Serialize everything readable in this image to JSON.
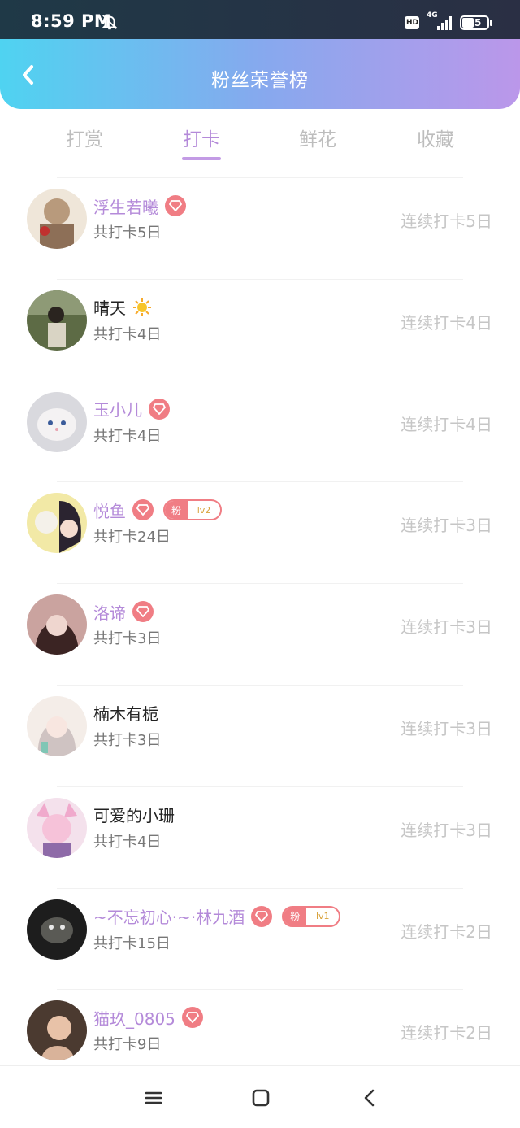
{
  "status_bar": {
    "time": "8:59 PM",
    "hd": "HD",
    "network": "4G",
    "battery": "45"
  },
  "header": {
    "title": "粉丝荣誉榜",
    "back_icon": "chevron-left-icon"
  },
  "tabs": [
    {
      "label": "打赏",
      "active": false
    },
    {
      "label": "打卡",
      "active": true
    },
    {
      "label": "鲜花",
      "active": false
    },
    {
      "label": "收藏",
      "active": false
    }
  ],
  "colors": {
    "accent": "#b48ad9",
    "badge": "#f07d84",
    "header_gradient": [
      "#4fd3f1",
      "#bb97ea"
    ]
  },
  "fans": [
    {
      "name": "浮生若曦",
      "vip": true,
      "total": "共打卡5日",
      "streak": "连续打卡5日"
    },
    {
      "name": "晴天",
      "vip": false,
      "emoji": "sun-icon",
      "total": "共打卡4日",
      "streak": "连续打卡4日"
    },
    {
      "name": "玉小儿",
      "vip": true,
      "total": "共打卡4日",
      "streak": "连续打卡4日"
    },
    {
      "name": "悦鱼",
      "vip": true,
      "fan_badge": {
        "label": "粉",
        "level": "lv2"
      },
      "total": "共打卡24日",
      "streak": "连续打卡3日"
    },
    {
      "name": "洛谛",
      "vip": true,
      "total": "共打卡3日",
      "streak": "连续打卡3日"
    },
    {
      "name": "楠木有栀",
      "vip": false,
      "total": "共打卡3日",
      "streak": "连续打卡3日"
    },
    {
      "name": "可爱的小珊",
      "vip": false,
      "total": "共打卡4日",
      "streak": "连续打卡3日"
    },
    {
      "name": "~不忘初心·~·林九酒",
      "vip": true,
      "fan_badge": {
        "label": "粉",
        "level": "lv1"
      },
      "total": "共打卡15日",
      "streak": "连续打卡2日"
    },
    {
      "name": "猫玖_0805",
      "vip": true,
      "total": "共打卡9日",
      "streak": "连续打卡2日"
    }
  ],
  "nav": {
    "menu_icon": "menu-icon",
    "home_icon": "home-square-icon",
    "back_icon": "back-chevron-icon"
  }
}
